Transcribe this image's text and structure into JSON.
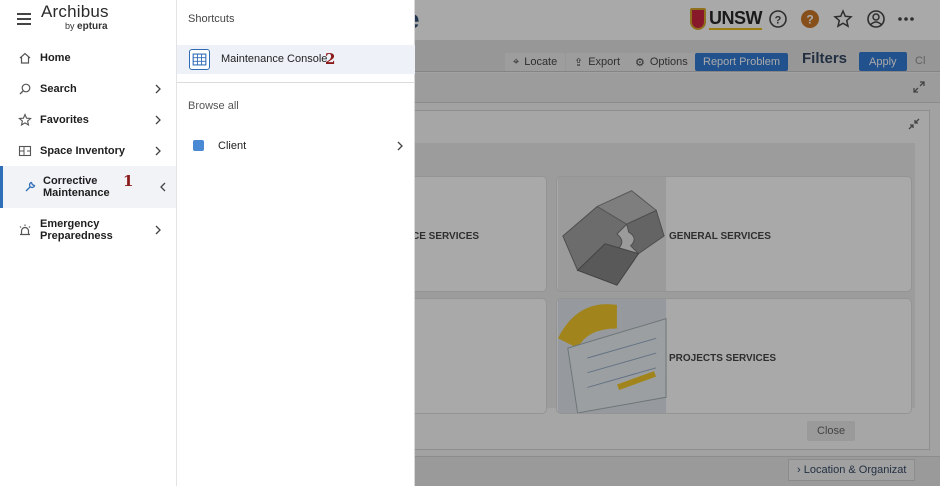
{
  "background": {
    "page_title_fragment": "e",
    "logo_text": "UNSW",
    "toolbar": {
      "locate": "Locate",
      "export": "Export",
      "options": "Options",
      "report_problem": "Report Problem",
      "filters": "Filters",
      "apply": "Apply",
      "clear_fragment": "Cl"
    },
    "tiles": [
      {
        "label": "CE SERVICES"
      },
      {
        "label": "GENERAL SERVICES"
      },
      {
        "label": "PROJECTS SERVICES"
      }
    ],
    "close_label": "Close",
    "footer_tab": "Location & Organizat"
  },
  "brand": {
    "name": "Archibus",
    "by": "by",
    "sub": "eptura"
  },
  "nav": {
    "items": [
      {
        "label": "Home",
        "icon": "home-icon"
      },
      {
        "label": "Search",
        "icon": "search-icon"
      },
      {
        "label": "Favorites",
        "icon": "star-icon"
      },
      {
        "label": "Space Inventory",
        "icon": "floorplan-icon"
      },
      {
        "label_line1": "Corrective",
        "label_line2": "Maintenance",
        "icon": "wrench-icon",
        "active": true
      },
      {
        "label_line1": "Emergency",
        "label_line2": "Preparedness",
        "icon": "alarm-icon"
      }
    ],
    "annotation_1": "1"
  },
  "shortcuts": {
    "title": "Shortcuts",
    "items": [
      {
        "label": "Maintenance Console",
        "icon": "grid-table-icon"
      }
    ],
    "annotation_2": "2",
    "browse_all": "Browse all",
    "browse_items": [
      {
        "label": "Client",
        "color": "#4a8ad4"
      }
    ]
  },
  "colors": {
    "accent": "#2f6fb8",
    "primary_button": "#1f6fd1",
    "annotation": "#8b1a1a"
  }
}
